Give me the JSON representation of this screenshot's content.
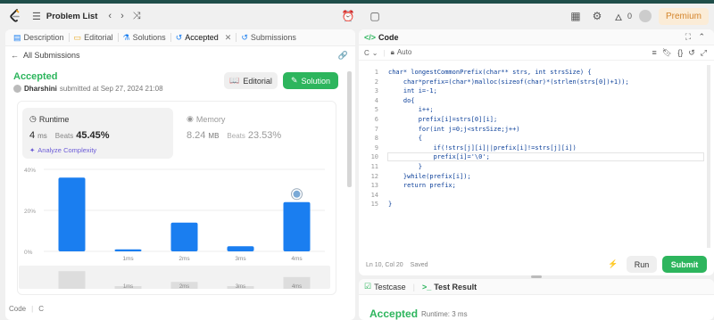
{
  "nav": {
    "problem_list": "Problem List",
    "streak_count": "0",
    "premium": "Premium"
  },
  "left_tabs": [
    {
      "label": "Description"
    },
    {
      "label": "Editorial"
    },
    {
      "label": "Solutions"
    },
    {
      "label": "Accepted"
    },
    {
      "label": "Submissions"
    }
  ],
  "submission": {
    "back_label": "All Submissions",
    "status": "Accepted",
    "user": "Dharshini",
    "submitted_text": "submitted at Sep 27, 2024 21:08",
    "editorial_btn": "Editorial",
    "solution_btn": "Solution",
    "runtime_label": "Runtime",
    "runtime_value": "4",
    "runtime_unit": "ms",
    "runtime_beats_label": "Beats",
    "runtime_beats": "45.45%",
    "analyze": "Analyze Complexity",
    "memory_label": "Memory",
    "memory_value": "8.24",
    "memory_unit": "MB",
    "memory_beats_label": "Beats",
    "memory_beats": "23.53%"
  },
  "chart_data": {
    "type": "bar",
    "categories": [
      "0ms",
      "1ms",
      "2ms",
      "3ms",
      "4ms"
    ],
    "values": [
      36,
      1,
      14,
      2.5,
      24
    ],
    "ytick_labels": [
      "40%",
      "20%",
      "0%"
    ],
    "ylim": [
      0,
      40
    ],
    "highlight_index": 4,
    "xtick_labels": [
      "",
      "1ms",
      "2ms",
      "3ms",
      "4ms"
    ],
    "navigator_labels": [
      "1ms",
      "2ms",
      "3ms",
      "4ms"
    ],
    "bar_color": "#1a7ef0"
  },
  "left_footer": {
    "code": "Code",
    "lang": "C"
  },
  "code_panel": {
    "title": "Code",
    "lang": "C",
    "auto": "Auto",
    "lines": [
      "char* longestCommonPrefix(char** strs, int strsSize) {",
      "    char*prefix=(char*)malloc(sizeof(char)*(strlen(strs[0])+1));",
      "    int i=-1;",
      "    do{",
      "        i++;",
      "        prefix[i]=strs[0][i];",
      "        for(int j=0;j<strsSize;j++)",
      "        {",
      "            if(!strs[j][i]||prefix[i]!=strs[j][i])",
      "            prefix[i]='\\0';",
      "        }",
      "    }while(prefix[i]);",
      "    return prefix;",
      "",
      "}"
    ],
    "line_numbers": [
      "1",
      "2",
      "3",
      "4",
      "5",
      "6",
      "7",
      "8",
      "9",
      "10",
      "11",
      "12",
      "13",
      "14",
      "15"
    ],
    "status_pos": "Ln 10, Col 20",
    "status_saved": "Saved",
    "run_btn": "Run",
    "submit_btn": "Submit"
  },
  "bottom": {
    "testcase": "Testcase",
    "result_tab": "Test Result",
    "accepted": "Accepted",
    "runtime": "Runtime: 3 ms"
  }
}
